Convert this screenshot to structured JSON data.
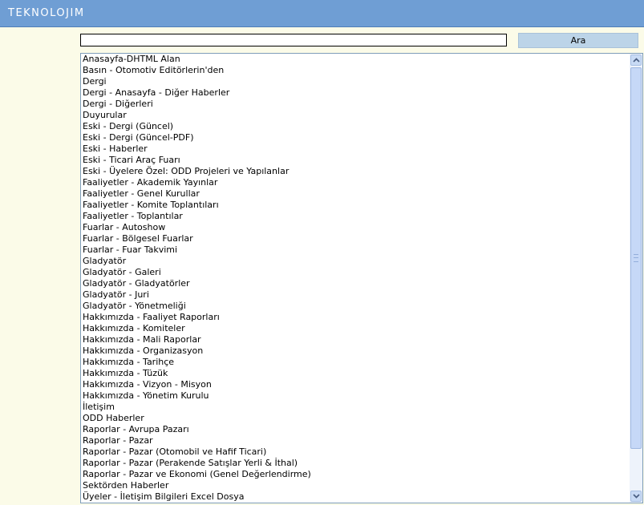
{
  "header": {
    "logo_text": "TEKNOLOJIM",
    "accent_color": "#6f9ed4"
  },
  "search": {
    "value": "",
    "button_label": "Ara"
  },
  "list": {
    "items": [
      "Anasayfa-DHTML Alan",
      "Basın - Otomotiv Editörlerin'den",
      "Dergi",
      "Dergi - Anasayfa - Diğer Haberler",
      "Dergi - Diğerleri",
      "Duyurular",
      "Eski - Dergi (Güncel)",
      "Eski - Dergi (Güncel-PDF)",
      "Eski - Haberler",
      "Eski - Ticari Araç Fuarı",
      "Eski - Üyelere Özel: ODD Projeleri ve Yapılanlar",
      "Faaliyetler - Akademik Yayınlar",
      "Faaliyetler - Genel Kurullar",
      "Faaliyetler - Komite Toplantıları",
      "Faaliyetler - Toplantılar",
      "Fuarlar - Autoshow",
      "Fuarlar - Bölgesel Fuarlar",
      "Fuarlar - Fuar Takvimi",
      "Gladyatör",
      "Gladyatör - Galeri",
      "Gladyatör - Gladyatörler",
      "Gladyatör - Juri",
      "Gladyatör - Yönetmeliği",
      "Hakkımızda - Faaliyet Raporları",
      "Hakkımızda - Komiteler",
      "Hakkımızda - Mali Raporlar",
      "Hakkımızda - Organizasyon",
      "Hakkımızda - Tarihçe",
      "Hakkımızda - Tüzük",
      "Hakkımızda - Vizyon - Misyon",
      "Hakkımızda - Yönetim Kurulu",
      "İletişim",
      "ODD Haberler",
      "Raporlar - Avrupa Pazarı",
      "Raporlar - Pazar",
      "Raporlar - Pazar (Otomobil ve Hafif Ticari)",
      "Raporlar - Pazar (Perakende Satışlar Yerli & İthal)",
      "Raporlar - Pazar ve Ekonomi (Genel Değerlendirme)",
      "Sektörden Haberler",
      "Üyeler - İletişim Bilgileri Excel Dosya"
    ]
  },
  "scrollbar": {
    "up_icon": "arrow-up-icon",
    "down_icon": "arrow-down-icon"
  }
}
